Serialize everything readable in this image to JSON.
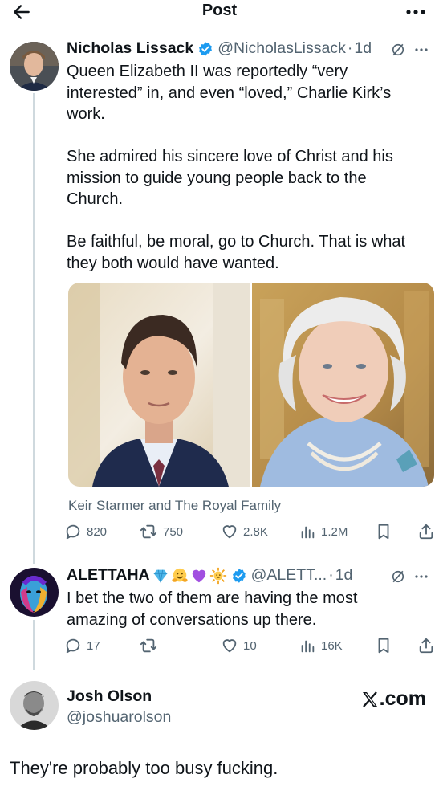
{
  "header": {
    "title": "Post",
    "back_icon": "arrow-left-icon",
    "more_icon": "more-horizontal-icon"
  },
  "colors": {
    "text": "#0f1419",
    "secondary": "#536471",
    "verified": "#1d9bf0",
    "thread_line": "#cfd9de"
  },
  "main_post": {
    "name": "Nicholas Lissack",
    "handle": "@NicholasLissack",
    "separator": "·",
    "time": "1d",
    "paragraphs": [
      "Queen Elizabeth II was reportedly “very interested” in, and even “loved,” Charlie Kirk’s work.",
      "She admired his sincere love of Christ and his mission to guide young people back to the Church.",
      "Be faithful, be moral, go to Church. That is what they both would have wanted."
    ],
    "source": "Keir Starmer and The Royal Family",
    "stats": {
      "replies": "820",
      "reposts": "750",
      "likes": "2.8K",
      "views": "1.2M"
    }
  },
  "reply": {
    "name": "ALETTAHA",
    "name_emojis": [
      "blue-diamond-icon",
      "hugging-face-icon",
      "purple-heart-icon",
      "sun-face-icon"
    ],
    "handle": "@ALETT...",
    "separator": "·",
    "time": "1d",
    "text": "I bet the two of them are having the most amazing of conversations up there.",
    "stats": {
      "replies": "17",
      "reposts": "",
      "likes": "10",
      "views": "16K"
    }
  },
  "quote_card": {
    "name": "Josh Olson",
    "handle": "@joshuarolson",
    "brand": ".com",
    "text": "They're probably too busy fucking."
  }
}
